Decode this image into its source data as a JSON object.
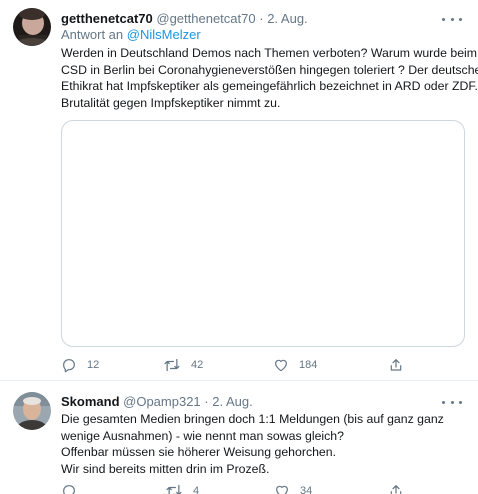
{
  "tweets": [
    {
      "display_name": "getthenetcat70",
      "handle": "@getthenetcat70",
      "separator": "·",
      "date": "2. Aug.",
      "reply_prefix": "Antwort an",
      "reply_to": "@NilsMelzer",
      "body_lines": [
        "Werden in Deutschland Demos nach Themen verboten? Warum wurde beim",
        "CSD in Berlin bei Coronahygieneverstößen hingegen toleriert ? Der deutsche",
        "Ethikrat hat Impfskeptiker als gemeingefährlich bezeichnet in ARD oder ZDF.",
        "Brutalität gegen Impfskeptiker nimmt zu."
      ],
      "counts": {
        "replies": "12",
        "retweets": "42",
        "likes": "184"
      }
    },
    {
      "display_name": "Skomand",
      "handle": "@Opamp321",
      "separator": "·",
      "date": "2. Aug.",
      "body_lines": [
        "Die gesamten Medien bringen doch 1:1 Meldungen (bis auf ganz ganz",
        "wenige Ausnahmen) - wie nennt man sowas gleich?",
        "Offenbar müssen sie höherer Weisung gehorchen.",
        "Wir sind bereits mitten drin im Prozeß."
      ],
      "counts": {
        "replies": "",
        "retweets": "4",
        "likes": "34"
      }
    }
  ],
  "icons": {
    "reply": "reply-bubble-icon",
    "retweet": "retweet-icon",
    "like": "heart-icon",
    "share": "share-upload-icon",
    "more": "more-dots-icon"
  },
  "colors": {
    "text": "#14171a",
    "secondary": "#657786",
    "link": "#1b95e0",
    "border": "#e6ecf0",
    "media_border": "#ccd6dd"
  }
}
